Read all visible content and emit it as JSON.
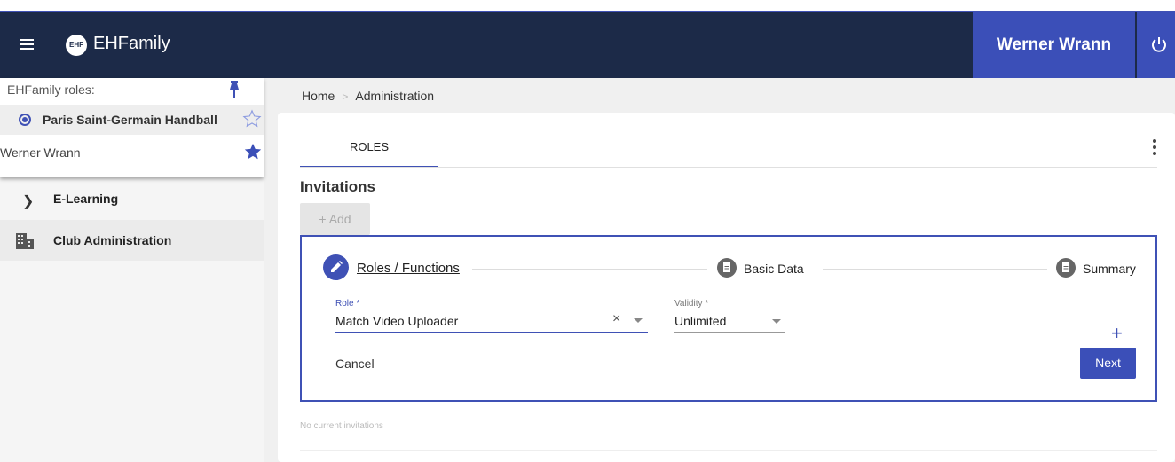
{
  "header": {
    "app_title": "EHFamily",
    "logo_text": "EHF",
    "user_name": "Werner Wrann"
  },
  "sidebar": {
    "roles_label": "EHFamily roles:",
    "selected_role": "Paris Saint-Germain Handball",
    "user_name": "Werner Wrann",
    "nav": [
      {
        "label": "E-Learning"
      },
      {
        "label": "Club Administration"
      }
    ]
  },
  "breadcrumb": {
    "items": [
      "Home",
      "Administration"
    ],
    "separator": ">"
  },
  "main": {
    "tab_label": "ROLES",
    "section_title": "Invitations",
    "add_label": "Add",
    "add_icon": "+",
    "steps": [
      {
        "label": "Roles / Functions"
      },
      {
        "label": "Basic Data"
      },
      {
        "label": "Summary"
      }
    ],
    "role_field": {
      "label": "Role *",
      "value": "Match Video Uploader"
    },
    "validity_field": {
      "label": "Validity *",
      "value": "Unlimited"
    },
    "clear_icon": "×",
    "plus_icon": "+",
    "cancel_label": "Cancel",
    "next_label": "Next",
    "empty_text": "No current invitations"
  },
  "colors": {
    "topbar": "#1c2a48",
    "accent": "#3b4fb8"
  }
}
